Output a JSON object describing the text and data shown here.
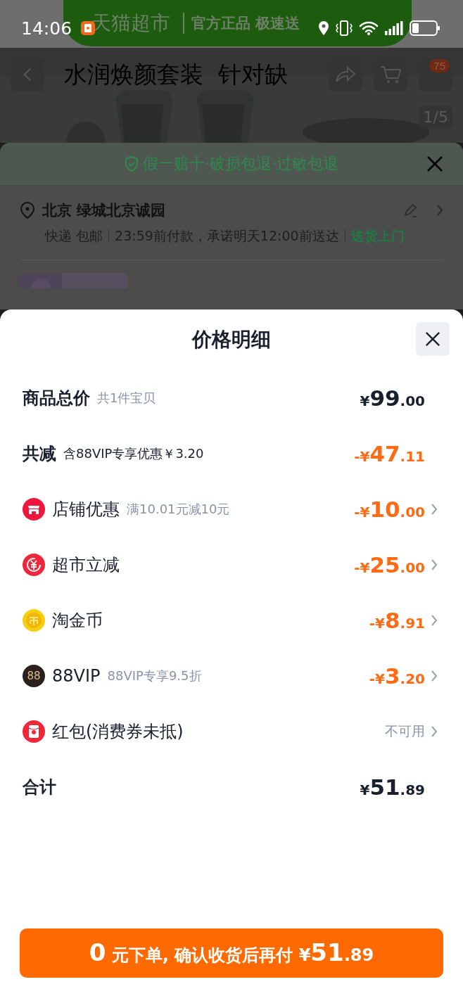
{
  "status_bar": {
    "time": "14:06"
  },
  "banner": {
    "brand": "天猫超市",
    "slogan": "官方正品 极速送"
  },
  "product_header": {
    "title": "水润焕颜套装  针对缺",
    "cart_badge": "75",
    "image_counter": "1/5"
  },
  "service_sheet": {
    "guarantee": "假一赔十·破损包退·过敏包退",
    "address": "北京 绿城北京诚园",
    "delivery": [
      {
        "text": "快递 包邮",
        "highlighted": false
      },
      {
        "text": "23:59前付款，承诺明天12:00前送达",
        "highlighted": false
      },
      {
        "text": "送货上门",
        "highlighted": true
      }
    ]
  },
  "price_detail": {
    "title": "价格明细",
    "rows": [
      {
        "kind": "none",
        "label": "商品总价",
        "bold": true,
        "note": "共1件宝贝",
        "note_muted": true,
        "amount": {
          "prefix": "¥",
          "major": "99",
          "minor": ".00",
          "discount": false
        },
        "arrow": false
      },
      {
        "kind": "none",
        "label": "共减",
        "bold": true,
        "note": "含88VIP专享优惠￥3.20",
        "note_muted": false,
        "amount": {
          "prefix": "-¥",
          "major": "47",
          "minor": ".11",
          "discount": true
        },
        "arrow": false
      },
      {
        "kind": "shop",
        "label": "店铺优惠",
        "bold": false,
        "note": "满10.01元减10元",
        "note_muted": true,
        "amount": {
          "prefix": "-¥",
          "major": "10",
          "minor": ".00",
          "discount": true
        },
        "arrow": true
      },
      {
        "kind": "yuan",
        "label": "超市立减",
        "bold": false,
        "amount": {
          "prefix": "-¥",
          "major": "25",
          "minor": ".00",
          "discount": true
        },
        "arrow": true
      },
      {
        "kind": "coin",
        "label": "淘金币",
        "bold": false,
        "amount": {
          "prefix": "-¥",
          "major": "8",
          "minor": ".91",
          "discount": true
        },
        "arrow": true
      },
      {
        "kind": "vip",
        "badge": "88",
        "label": "88VIP",
        "bold": false,
        "note": "88VIP专享9.5折",
        "note_muted": true,
        "amount": {
          "prefix": "-¥",
          "major": "3",
          "minor": ".20",
          "discount": true
        },
        "arrow": true
      },
      {
        "kind": "redpacket",
        "label": "红包(消费券未抵)",
        "bold": false,
        "status": "不可用",
        "arrow": true
      },
      {
        "kind": "none",
        "label": "合计",
        "bold": true,
        "amount": {
          "prefix": "¥",
          "major": "51",
          "minor": ".89",
          "discount": false
        },
        "arrow": false
      }
    ]
  },
  "submit_button": {
    "segments": [
      {
        "text": "0",
        "emphasized": true
      },
      {
        "text": " 元下单, 确认收货后再付 ¥",
        "emphasized": false
      },
      {
        "text": "51",
        "emphasized": true
      },
      {
        "text": ".89",
        "emphasized": false
      }
    ]
  }
}
